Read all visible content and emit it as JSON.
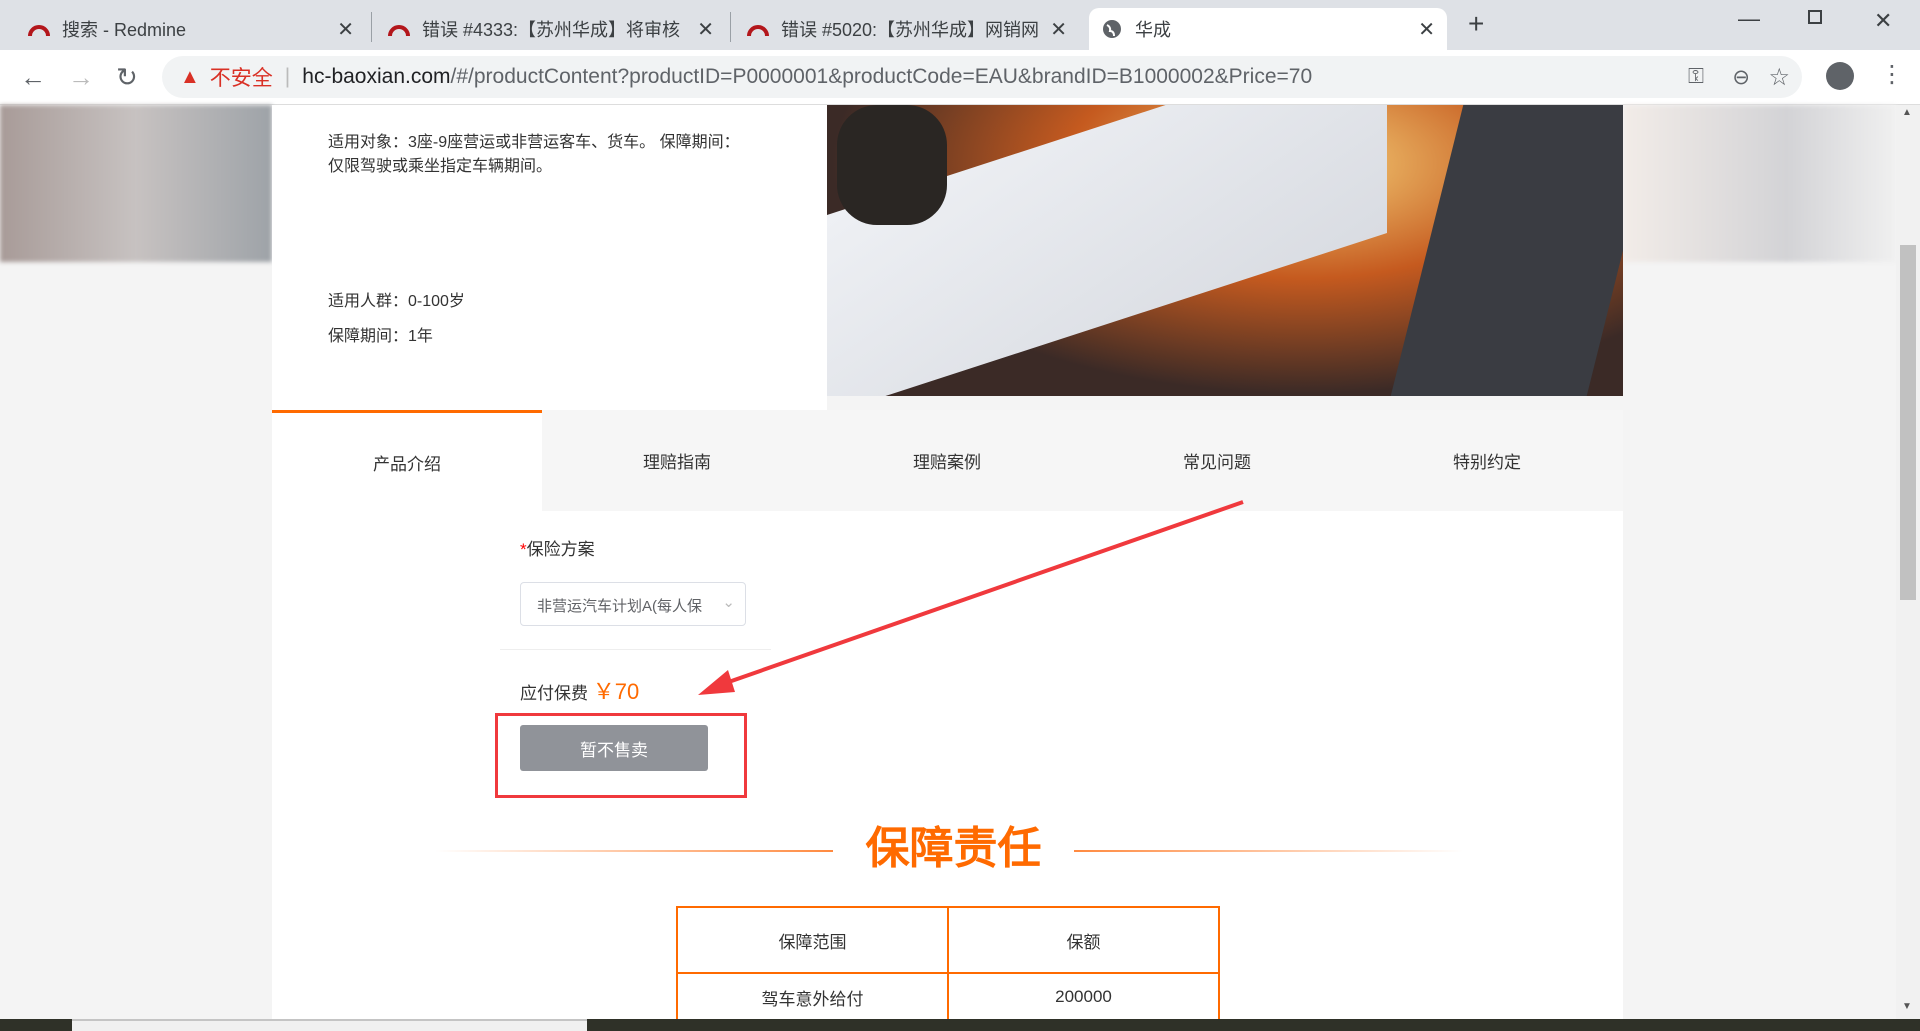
{
  "browser": {
    "tabs": [
      {
        "title": "搜索 - Redmine",
        "icon": "redmine-icon"
      },
      {
        "title": "错误 #4333:【苏州华成】将审核",
        "icon": "redmine-icon"
      },
      {
        "title": "错误 #5020:【苏州华成】网销网",
        "icon": "redmine-icon"
      },
      {
        "title": "华成",
        "icon": "globe-icon"
      }
    ],
    "insecure_label": "不安全",
    "url_host": "hc-baoxian.com",
    "url_path": "/#/productContent?productID=P0000001&productCode=EAU&brandID=B1000002&Price=70"
  },
  "product": {
    "target": "适用对象：3座-9座营运或非营运客车、货车。 保障期间：仅限驾驶或乘坐指定车辆期间。",
    "age": "适用人群：0-100岁",
    "period": "保障期间：1年"
  },
  "tabs": [
    "产品介绍",
    "理赔指南",
    "理赔案例",
    "常见问题",
    "特别约定"
  ],
  "form": {
    "required_mark": "*",
    "plan_label": "保险方案",
    "plan_value": "非营运汽车计划A(每人保",
    "premium_label": "应付保费",
    "premium_value": "￥70",
    "button": "暂不售卖"
  },
  "coverage": {
    "title": "保障责任",
    "headers": [
      "保障范围",
      "保额"
    ],
    "rows": [
      [
        "驾车意外给付",
        "200000"
      ]
    ]
  },
  "colors": {
    "accent": "#ff6a00",
    "annotation": "#f0393d"
  }
}
